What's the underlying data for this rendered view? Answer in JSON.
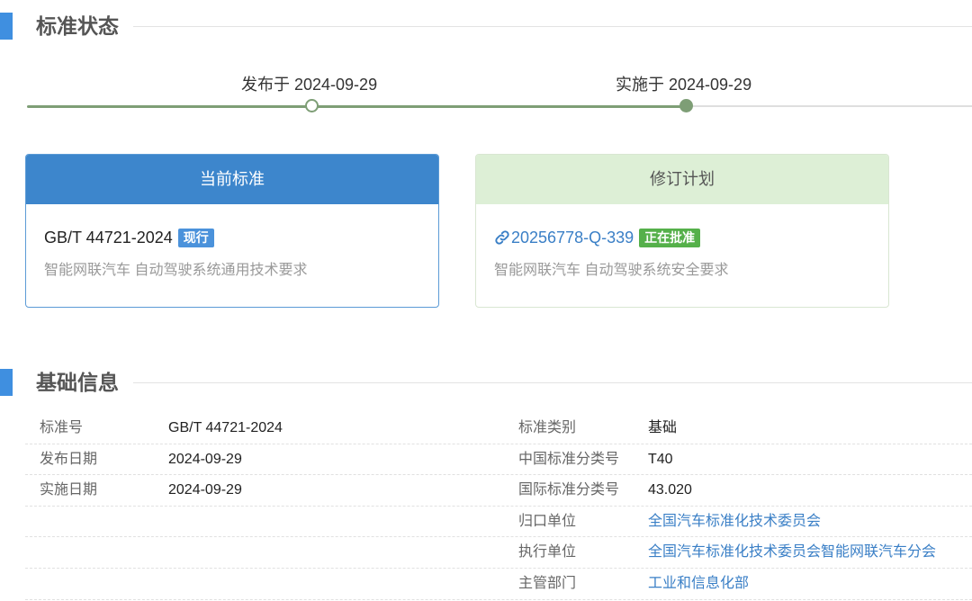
{
  "status_section": {
    "title": "标准状态"
  },
  "timeline": {
    "published_label": "发布于 2024-09-29",
    "implemented_label": "实施于 2024-09-29"
  },
  "current_standard": {
    "header": "当前标准",
    "code": "GB/T 44721-2024",
    "badge": "现行",
    "description": "智能网联汽车 自动驾驶系统通用技术要求"
  },
  "revision_plan": {
    "header": "修订计划",
    "icon": "link-icon",
    "code": "20256778-Q-339",
    "badge": "正在批准",
    "description": "智能网联汽车 自动驾驶系统安全要求"
  },
  "basic_section": {
    "title": "基础信息"
  },
  "basic_info": {
    "left": [
      {
        "label": "标准号",
        "value": "GB/T 44721-2024"
      },
      {
        "label": "发布日期",
        "value": "2024-09-29"
      },
      {
        "label": "实施日期",
        "value": "2024-09-29"
      }
    ],
    "right": [
      {
        "label": "标准类别",
        "value": "基础"
      },
      {
        "label": "中国标准分类号",
        "value": "T40"
      },
      {
        "label": "国际标准分类号",
        "value": "43.020"
      },
      {
        "label": "归口单位",
        "value": "全国汽车标准化技术委员会"
      },
      {
        "label": "执行单位",
        "value": "全国汽车标准化技术委员会智能网联汽车分会"
      },
      {
        "label": "主管部门",
        "value": "工业和信息化部"
      }
    ]
  },
  "colors": {
    "accent_blue": "#3d86cc",
    "timeline_green": "#7e9e76",
    "plan_header_green": "#ddefd6",
    "badge_green": "#55b04a",
    "link_blue": "#3a7fc6"
  }
}
